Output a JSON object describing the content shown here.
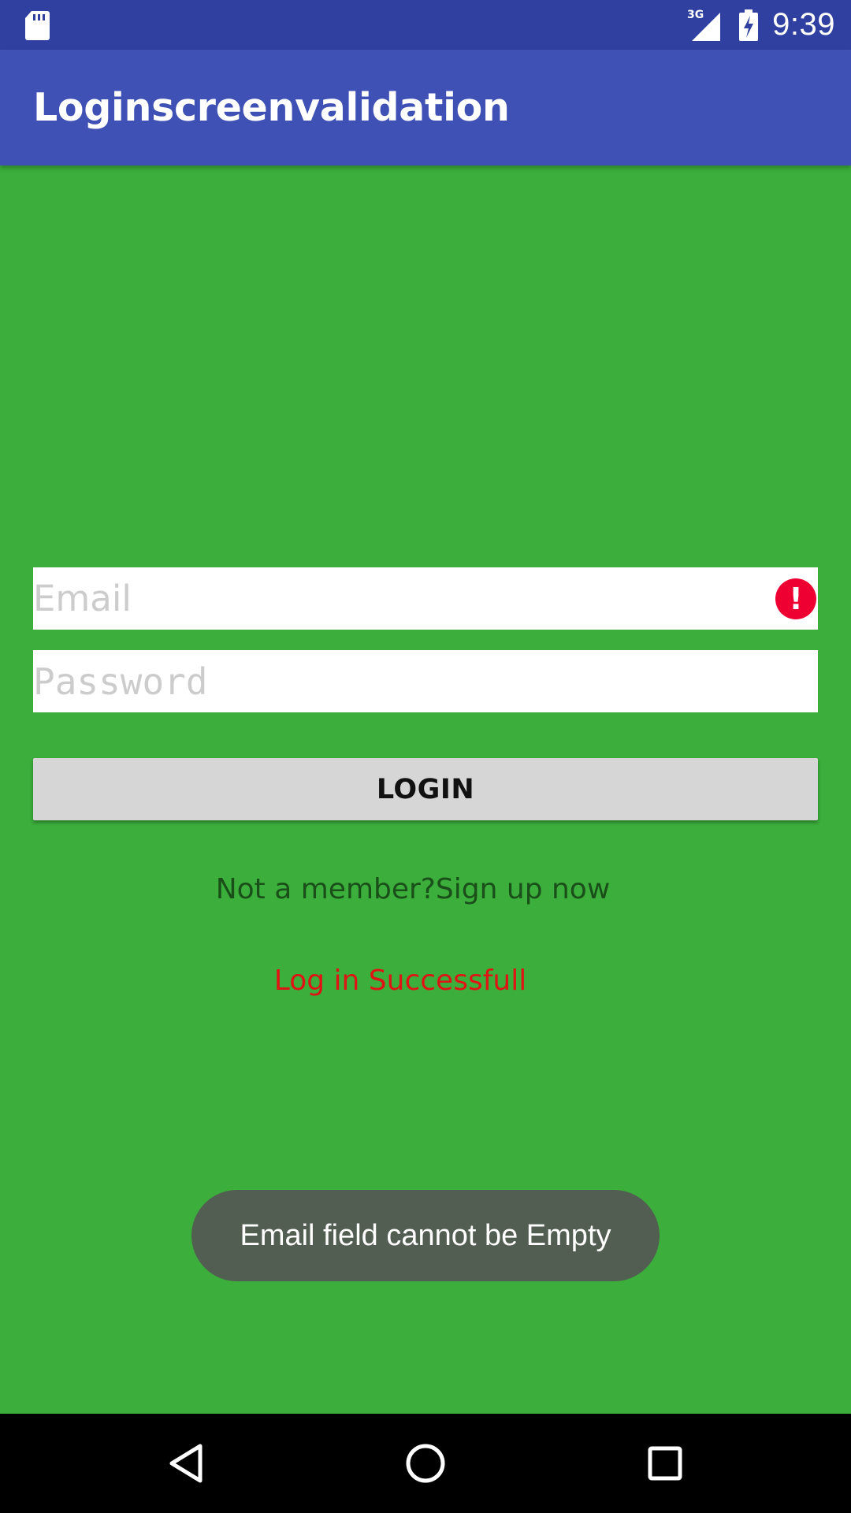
{
  "status_bar": {
    "time": "9:39",
    "network": "3G",
    "icons": [
      "sd-card-icon",
      "cellular-signal-icon",
      "battery-charging-icon"
    ]
  },
  "app_bar": {
    "title": "Loginscreenvalidation",
    "color": "#3f51b5"
  },
  "form": {
    "email_placeholder": "Email",
    "email_value": "",
    "email_error": true,
    "password_placeholder": "Password",
    "password_value": "",
    "login_label": "LOGIN",
    "signup_text": "Not a member?Sign up now",
    "status_text": "Log in Successfull"
  },
  "toast": {
    "message": "Email field cannot be Empty"
  },
  "nav_bar": {
    "icons": [
      "back-icon",
      "home-icon",
      "recents-icon"
    ]
  },
  "colors": {
    "background": "#3bae3b",
    "status_bar": "#3040a0",
    "error": "#ee0033",
    "status_text": "#e01414",
    "toast": "#535e52"
  }
}
